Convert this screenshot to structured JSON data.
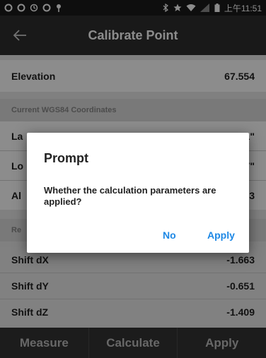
{
  "status_bar": {
    "time": "上午11:51",
    "left_icons": [
      "notification-icon",
      "notification-icon",
      "sync-icon",
      "notification-icon",
      "location-pin-icon"
    ],
    "right_icons": [
      "bluetooth-icon",
      "star-icon",
      "wifi-icon",
      "signal-icon",
      "battery-icon"
    ]
  },
  "app_bar": {
    "title": "Calibrate Point",
    "back_icon": "back-arrow-icon"
  },
  "elevation": {
    "label": "Elevation",
    "value": "67.554"
  },
  "wgs84": {
    "section_label": "Current WGS84 Coordinates",
    "rows": [
      {
        "label": "La",
        "value": "1\""
      },
      {
        "label": "Lo",
        "value": "7\""
      },
      {
        "label": "Al",
        "value": "53"
      }
    ]
  },
  "results": {
    "section_label": "Re",
    "rows": [
      {
        "label": "Shift dX",
        "value": "-1.663"
      },
      {
        "label": "Shift dY",
        "value": "-0.651"
      },
      {
        "label": "Shift dZ",
        "value": "-1.409"
      }
    ]
  },
  "toolbar": {
    "measure": "Measure",
    "calculate": "Calculate",
    "apply": "Apply"
  },
  "dialog": {
    "title": "Prompt",
    "message": "Whether the calculation parameters are applied?",
    "no": "No",
    "apply": "Apply"
  },
  "colors": {
    "accent": "#1e88e5",
    "app_bar": "#2f2f2f",
    "toolbar": "#333333"
  }
}
